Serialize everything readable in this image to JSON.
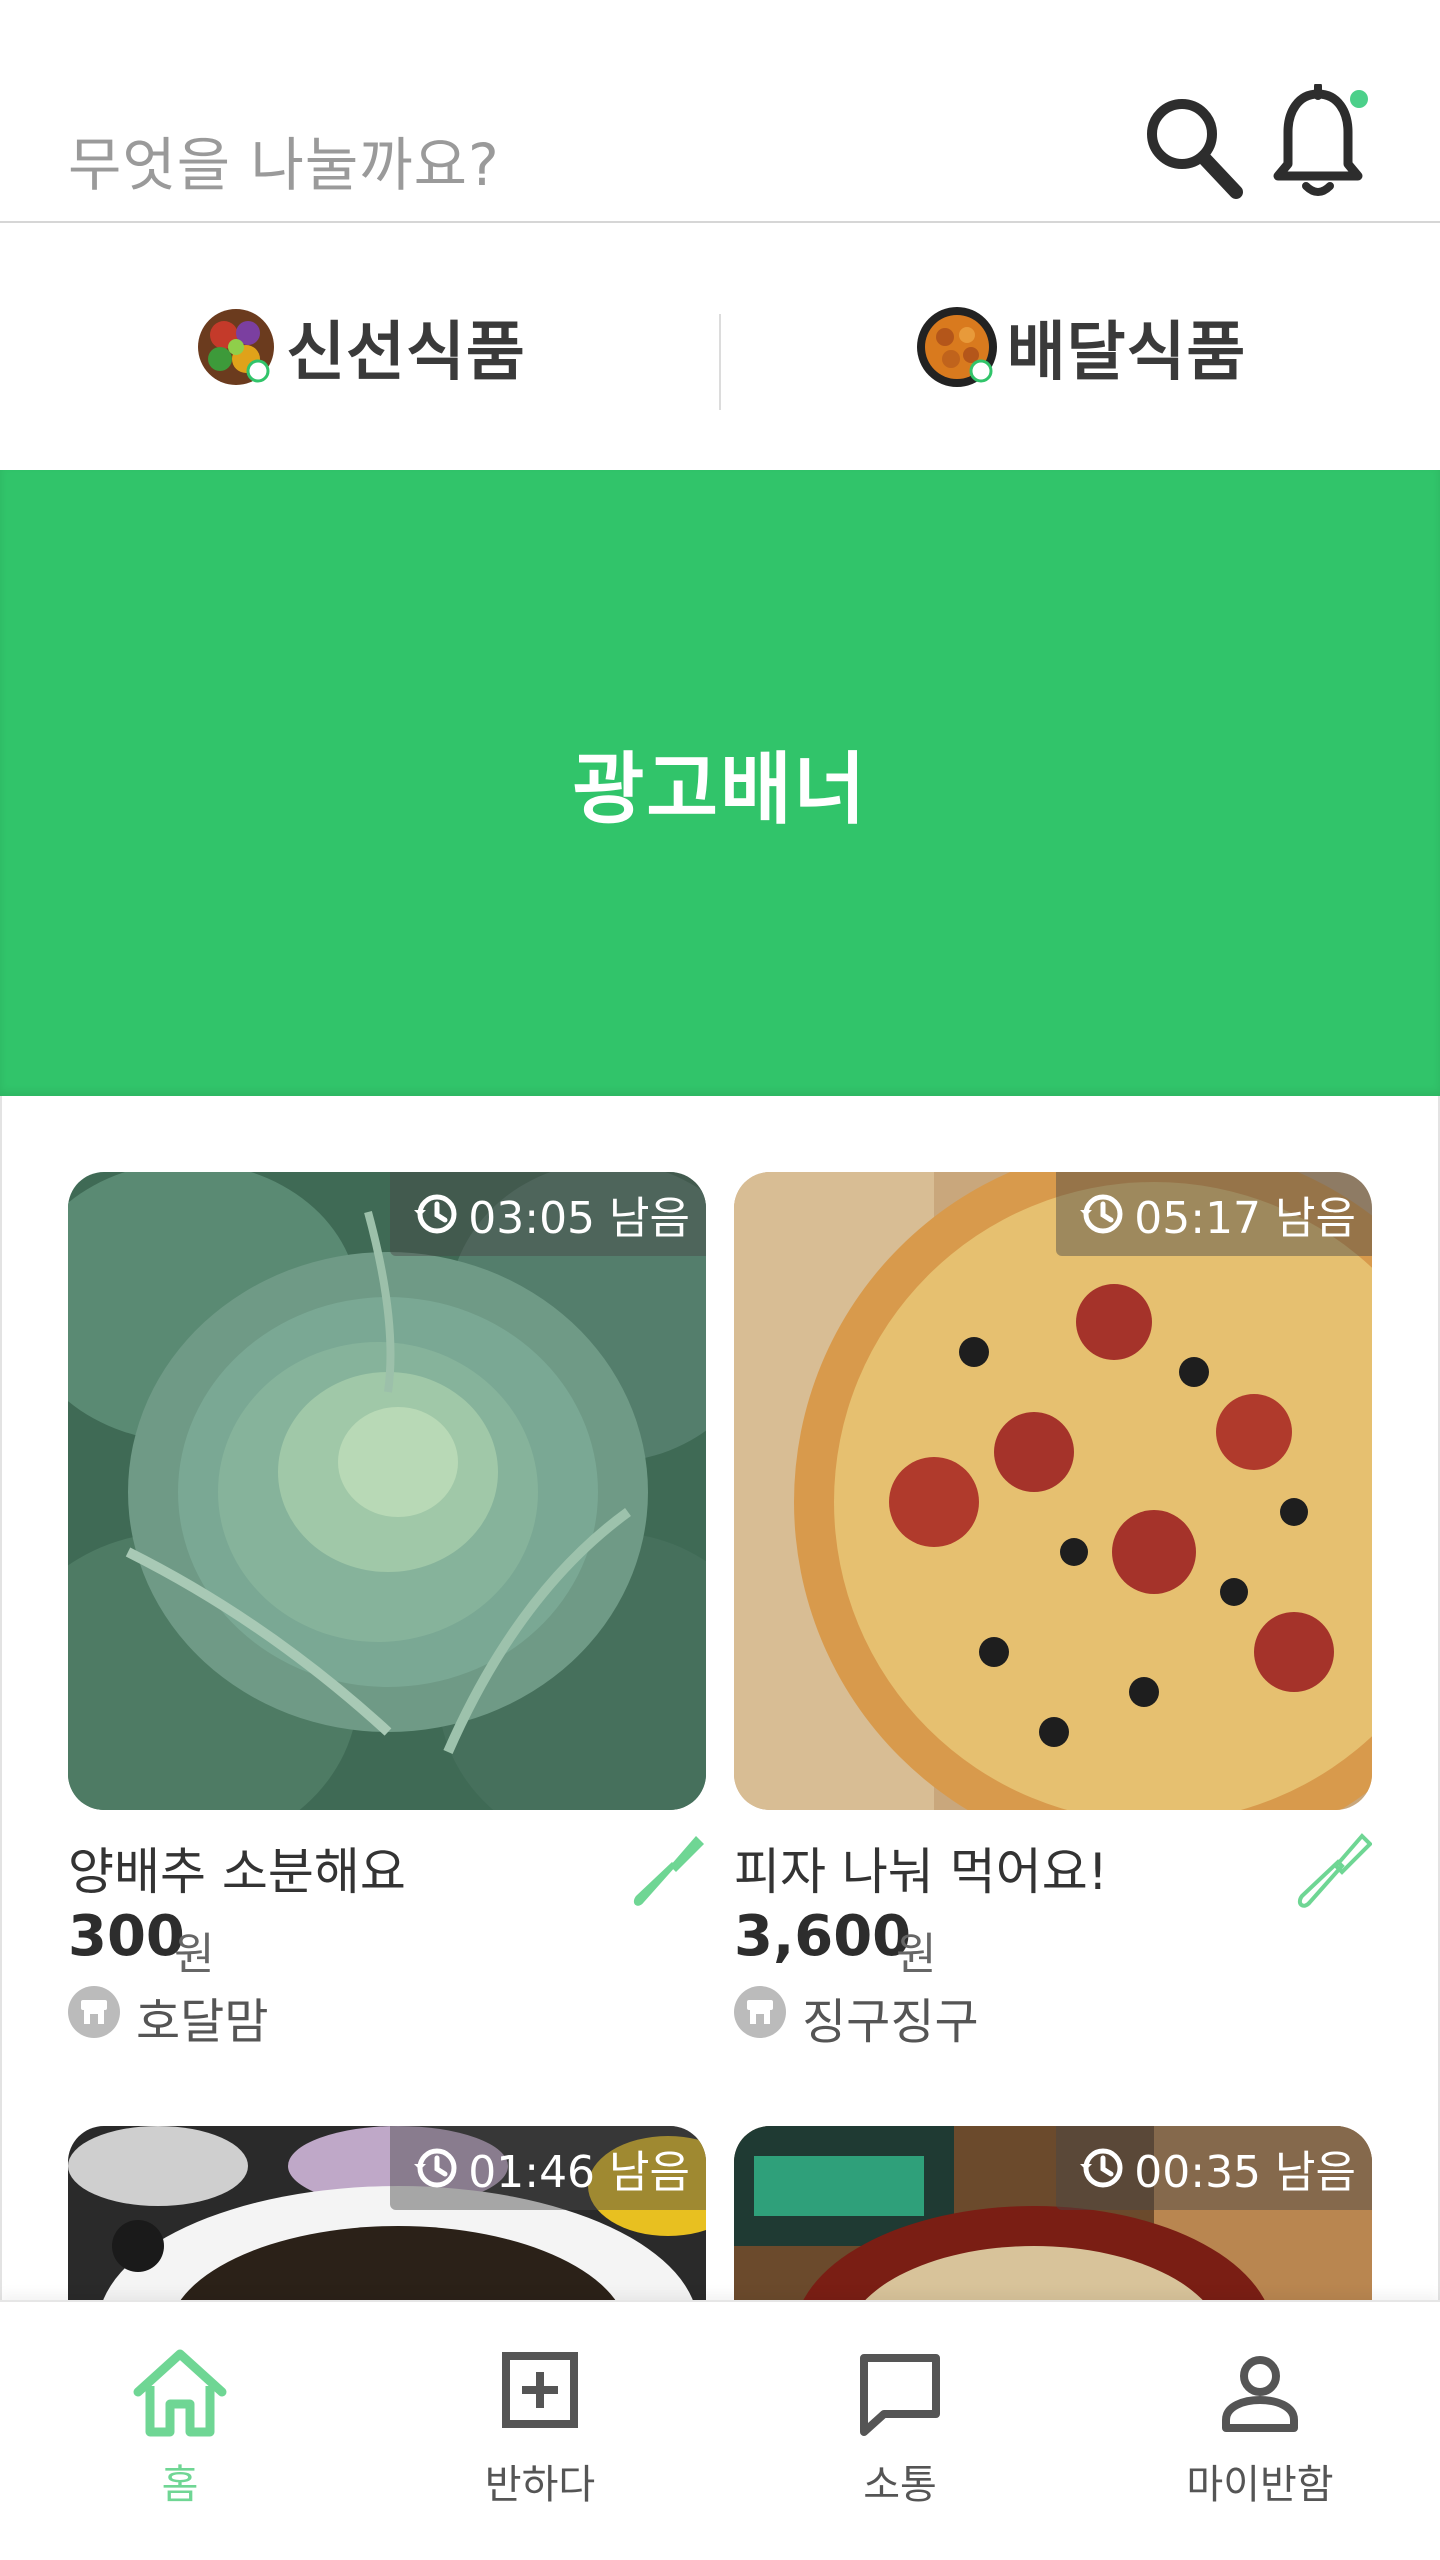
{
  "search": {
    "placeholder": "무엇을 나눌까요?"
  },
  "header": {
    "search_icon": "search-icon",
    "bell_icon": "bell-icon",
    "notification_dot_color": "#4cd08a"
  },
  "categories": [
    {
      "label": "신선식품",
      "icon": "vegetables-icon"
    },
    {
      "label": "배달식품",
      "icon": "fried-chicken-icon"
    }
  ],
  "banner": {
    "text": "광고배너",
    "color": "#31c46a"
  },
  "cards": [
    {
      "title": "양배추 소분해요",
      "price": "300",
      "currency": "원",
      "seller": "호달맘",
      "timer": "03:05 남음",
      "image": "cabbage-photo",
      "utensil_icon": "fork-filled-icon"
    },
    {
      "title": "피자 나눠 먹어요!",
      "price": "3,600",
      "currency": "원",
      "seller": "징구징구",
      "timer": "05:17 남음",
      "image": "pizza-photo",
      "utensil_icon": "fork-outline-icon"
    },
    {
      "timer": "01:46 남음",
      "image": "jajangmyeon-photo"
    },
    {
      "timer": "00:35 남음",
      "image": "udon-photo"
    }
  ],
  "bottom_nav": [
    {
      "label": "홈",
      "icon": "home-icon",
      "active": true
    },
    {
      "label": "반하다",
      "icon": "add-square-icon",
      "active": false
    },
    {
      "label": "소통",
      "icon": "chat-icon",
      "active": false
    },
    {
      "label": "마이반함",
      "icon": "person-icon",
      "active": false
    }
  ],
  "colors": {
    "accent": "#31c46a",
    "nav_active": "#6fd694"
  }
}
